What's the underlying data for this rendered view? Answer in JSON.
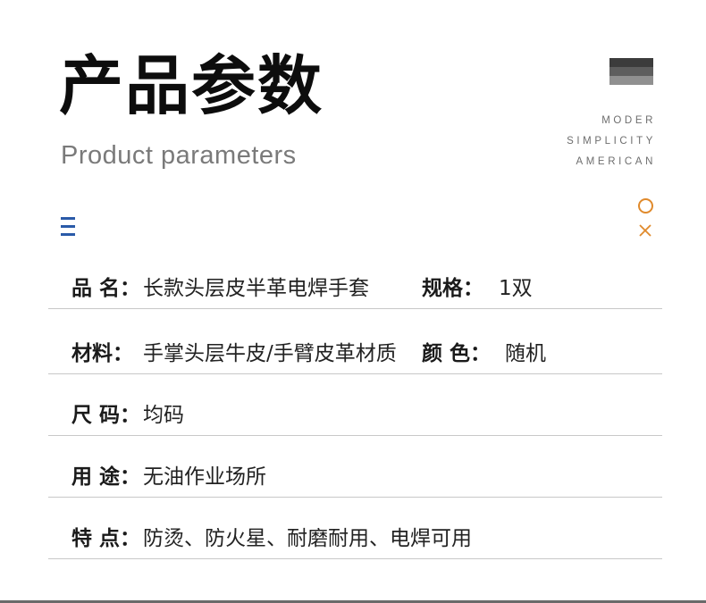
{
  "header": {
    "title_cn": "产品参数",
    "title_en": "Product parameters",
    "tagline": [
      "MODER",
      "SIMPLICITY",
      "AMERICAN"
    ]
  },
  "icons": {
    "menu": "menu-icon",
    "circle": "circle-icon",
    "close": "close-icon",
    "accent_color": "#e08a2c",
    "menu_color": "#2a5aa8"
  },
  "params": {
    "name_label": "品 名：",
    "name_value": "长款头层皮半革电焊手套",
    "spec_label": "规格：",
    "spec_value": "1双",
    "material_label": "材料：",
    "material_value": "手掌头层牛皮/手臂皮革材质",
    "color_label": "颜 色：",
    "color_value": "随机",
    "size_label": "尺 码：",
    "size_value": "均码",
    "use_label": "用 途：",
    "use_value": "无油作业场所",
    "feature_label": "特 点：",
    "feature_value": "防烫、防火星、耐磨耐用、电焊可用"
  }
}
